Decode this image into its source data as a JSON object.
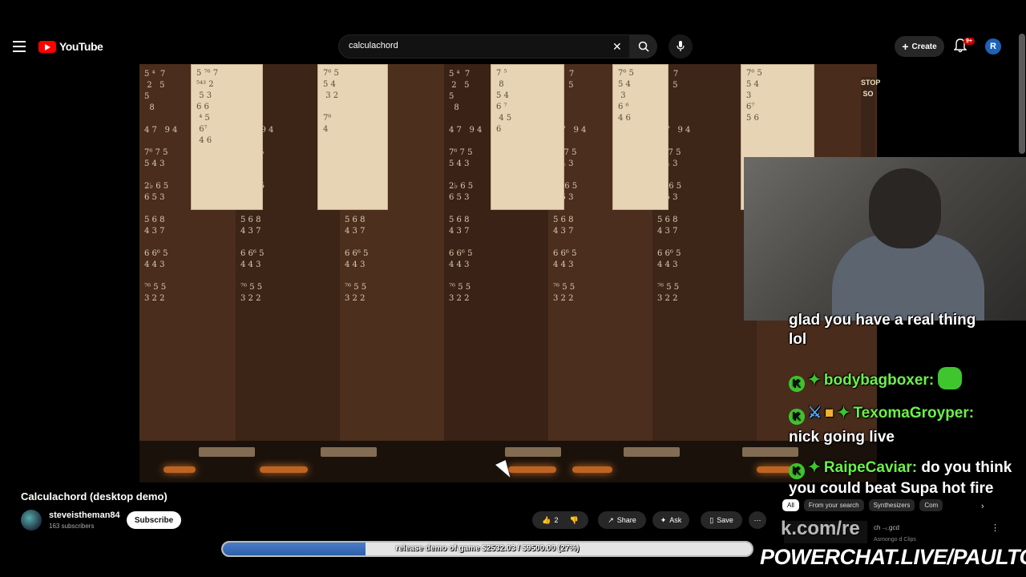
{
  "header": {
    "logo_text": "YouTube",
    "search_value": "calculachord",
    "create_label": "Create",
    "notification_badge": "9+",
    "avatar_letter": "R"
  },
  "video": {
    "stop_strip": "STOP\nSO",
    "cards": [
      "5 ⁷⁶ 7\n⁵⁴³ 2\n 5 3\n6 6\n ⁴ 5\n 6⁷\n 4 6",
      "7⁶ 5\n5 4\n 3 2\n\n7⁶\n4",
      "7 ⁵\n 8\n5 4\n6 ⁷\n 4 5\n6",
      "7⁶ 5\n5 4\n 3\n6 ⁶\n4 6",
      "7⁶ 5\n5 4\n3\n6⁷\n5 6"
    ],
    "column_glyphs": "5 ⁴  7\n 2   5\n5\n  8\n\n4 7   9 4\n\n7⁶ 7 5\n5 4 3\n\n2♭ 6 5\n6 5 3\n\n5 6 8\n4 3 7\n\n6 6⁶ 5\n4 4 3\n\n⁷⁶ 5 5\n3 2 2"
  },
  "chat": {
    "msg1_text": "glad you have a real thing lol",
    "msg2_user": "bodybagboxer:",
    "msg3_user": "TexomaGroyper:",
    "msg3_text": "nick going live",
    "msg4_user": "RaipeCaviar:",
    "msg4_text": "do you think you could beat Supa hot fire"
  },
  "below": {
    "title": "Calculachord (desktop demo)",
    "channel": "steveistheman84",
    "subscribers": "163 subscribers",
    "subscribe_label": "Subscribe",
    "like_count": "2",
    "share_label": "Share",
    "ask_label": "Ask",
    "save_label": "Save",
    "chips": [
      "All",
      "From your search",
      "Synthesizers",
      "Com"
    ],
    "rec_title": "ch  ₋ᵣ.gcd",
    "rec_sub": "Asmongo d Clips",
    "url_ghost": "k.com/re"
  },
  "overlay": {
    "progress_label": "release demo of game $2532.03 / $9500.00 (27%)",
    "progress_fraction": 0.27,
    "powerchat": "POWERCHAT.LIVE/PAULTOWN"
  },
  "colors": {
    "yt_red": "#ff0000",
    "chat_green": "#6cf04a",
    "progress_blue": "#2d5ea8"
  }
}
